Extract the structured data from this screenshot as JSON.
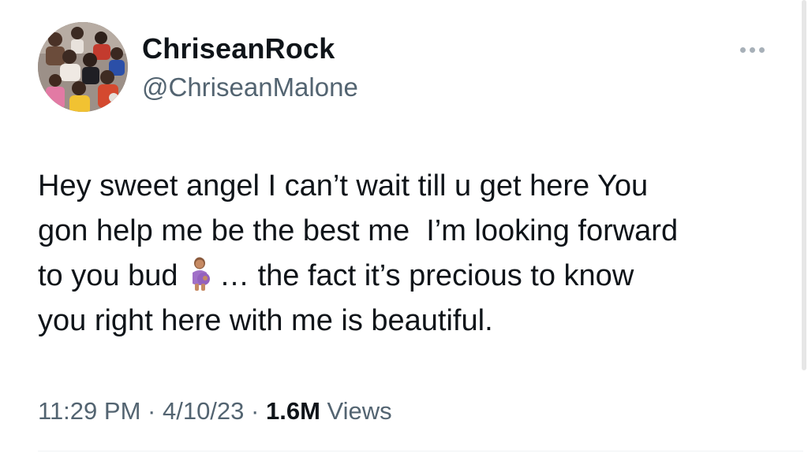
{
  "tweet": {
    "display_name": "ChriseanRock",
    "handle": "@ChriseanMalone",
    "text_before_emoji": "Hey sweet angel I can’t wait till u get here You\ngon help me be the best me  I’m looking forward\nto you bud ",
    "emoji_name": "pregnant-woman-emoji",
    "text_after_emoji": "… the fact it’s precious to know\nyou right here with me is beautiful.",
    "time": "11:29 PM",
    "separator": "·",
    "date": "4/10/23",
    "views_count": "1.6M",
    "views_label": "Views"
  },
  "icons": {
    "more": "more-horizontal-icon",
    "avatar": "profile-photo"
  },
  "colors": {
    "text_primary": "#0f1419",
    "text_secondary": "#536471",
    "icon_muted": "#a7b0b8",
    "divider": "#eff3f4",
    "background": "#ffffff"
  }
}
